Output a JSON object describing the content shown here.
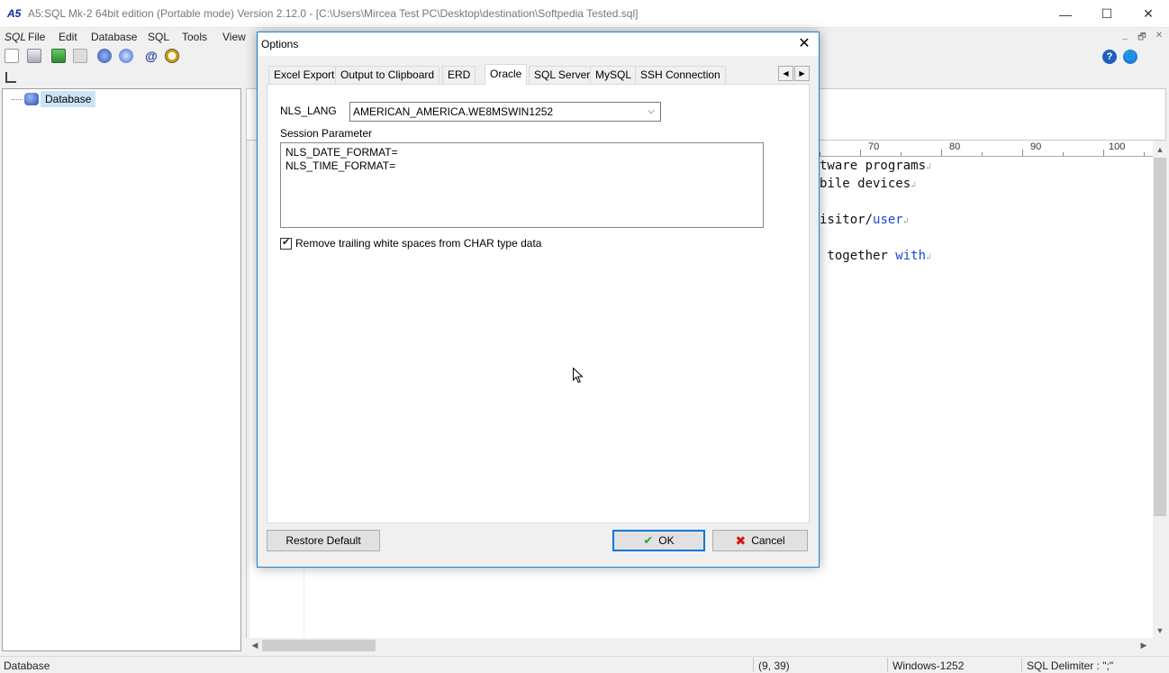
{
  "window": {
    "title": "A5:SQL Mk-2 64bit edition (Portable mode) Version 2.12.0 - [C:\\Users\\Mircea Test PC\\Desktop\\destination\\Softpedia Tested.sql]",
    "app_icon_text": "A5",
    "minimize": "—",
    "maximize": "☐",
    "close": "✕"
  },
  "menubar": {
    "logo": "SQL",
    "items": [
      "File",
      "Edit",
      "Database",
      "SQL",
      "Tools",
      "View"
    ],
    "mdi_minimize": "_",
    "mdi_restore": "🗗",
    "mdi_close": "✕"
  },
  "toolbar": {
    "icons": [
      "new-file-icon",
      "open-file-icon",
      "run-sql-icon",
      "copy-sql-icon",
      "database-icon",
      "gear-icon",
      "email-icon",
      "clock-icon"
    ],
    "help_icon": "?",
    "web_icon": "🌐"
  },
  "tree": {
    "root_label": "Database"
  },
  "ruler": {
    "labels": [
      "70",
      "80",
      "90",
      "100"
    ]
  },
  "editor": {
    "lines": [
      {
        "parts": [
          {
            "t": "tware programs",
            "kw": false
          }
        ]
      },
      {
        "parts": [
          {
            "t": "bile devices",
            "kw": false
          }
        ]
      },
      {
        "parts": []
      },
      {
        "parts": [
          {
            "t": "isitor",
            "kw": false
          },
          {
            "t": "/",
            "kw": false
          },
          {
            "t": "user",
            "kw": true
          }
        ]
      },
      {
        "parts": []
      },
      {
        "parts": [
          {
            "t": " together ",
            "kw": false
          },
          {
            "t": "with",
            "kw": true
          }
        ]
      }
    ],
    "eol_mark": "↲"
  },
  "statusbar": {
    "left": "Database",
    "position": "(9, 39)",
    "encoding": "Windows-1252",
    "delimiter": "SQL Delimiter : \";\""
  },
  "dialog": {
    "title": "Options",
    "close": "✕",
    "tabs": [
      "Excel Export",
      "Output to Clipboard",
      "ERD",
      "Oracle",
      "SQL Server",
      "MySQL",
      "SSH Connection"
    ],
    "active_tab": "Oracle",
    "tab_scroll_left": "◀",
    "tab_scroll_right": "▶",
    "nls_lang_label": "NLS_LANG",
    "nls_lang_value": "AMERICAN_AMERICA.WE8MSWIN1252",
    "session_param_label": "Session Parameter",
    "session_params": [
      "NLS_DATE_FORMAT=",
      "NLS_TIME_FORMAT="
    ],
    "trim_checkbox_label": "Remove trailing white spaces from CHAR type data",
    "trim_checked": true,
    "restore_default": "Restore Default",
    "ok": "OK",
    "cancel": "Cancel"
  }
}
